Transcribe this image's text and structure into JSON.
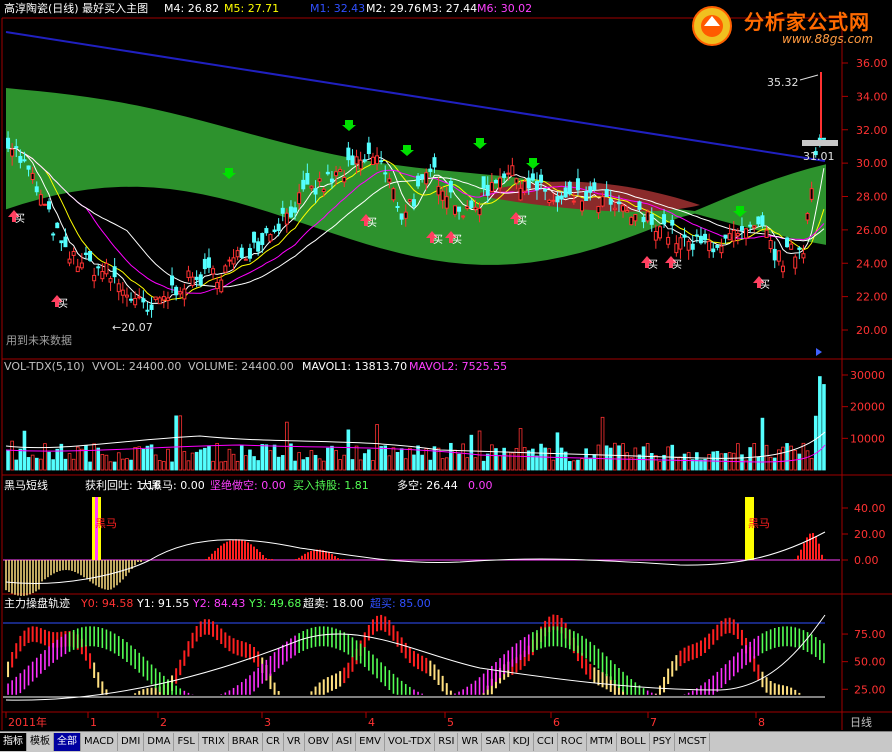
{
  "colors": {
    "up": "#ff3232",
    "down": "#54ffff",
    "ma_white": "#ffffff",
    "ma_yellow": "#ffff00",
    "ma_magenta": "#ff00ff",
    "ma_green": "#00ff00",
    "trend_blue": "#2020c0",
    "cloud_green": "#2f9a2f",
    "cloud_red": "#8a2a2a",
    "grid": "#b00000",
    "panel_border": "#a00000",
    "label_cyan": "#c0c0c0",
    "axis_text": "#ff3232"
  },
  "header": {
    "title": "高淳陶瓷(日线) 最好买入主图",
    "m4": "M4: 26.82",
    "m5": "M5: 27.71",
    "m1": "M1: 32.43",
    "m2": "M2: 29.76",
    "m3": "M3: 27.44",
    "m6": "M6: 30.02"
  },
  "watermark": {
    "brand": "分析家公式网",
    "url": "www.88gs.com"
  },
  "main_chart": {
    "price_axis": [
      "36.00",
      "34.00",
      "32.00",
      "30.00",
      "28.00",
      "26.00",
      "24.00",
      "22.00",
      "20.00"
    ],
    "high_label": "35.32",
    "low_label": "20.07",
    "last_label": "31.01",
    "future_note": "用到未来数据",
    "buy_marker_text": "买"
  },
  "volume_panel": {
    "title": "VOL-TDX(5,10)",
    "vvol": "VVOL: 24400.00",
    "volume": "VOLUME: 24400.00",
    "mavol1": "MAVOL1: 13813.70",
    "mavol2": "MAVOL2: 7525.55",
    "axis": [
      "30000",
      "20000",
      "10000"
    ]
  },
  "horse_panel": {
    "title": "黑马短线",
    "profit_back": "获利回吐: 1.16",
    "dark_horse": "大黑马: 0.00",
    "firm_empty": "坚绝做空: 0.00",
    "buy_hold": "买入持股: 1.81",
    "long_short": "多空: 26.44",
    "long_short_val2": "0.00",
    "marker": "黑马",
    "axis": [
      "40.00",
      "20.00",
      "0.00"
    ]
  },
  "track_panel": {
    "title": "主力操盘轨迹",
    "y0": "Y0: 94.58",
    "y1": "Y1: 91.55",
    "y2": "Y2: 84.43",
    "y3": "Y3: 49.68",
    "overbought": "超卖: 18.00",
    "oversold": "超买: 85.00",
    "axis": [
      "75.00",
      "50.00",
      "25.00"
    ]
  },
  "date_axis": {
    "labels": [
      "2011年",
      "1",
      "2",
      "3",
      "4",
      "5",
      "6",
      "7",
      "8"
    ],
    "period": "日线"
  },
  "tabs": [
    "指标",
    "模板",
    "全部",
    "MACD",
    "DMI",
    "DMA",
    "FSL",
    "TRIX",
    "BRAR",
    "CR",
    "VR",
    "OBV",
    "ASI",
    "EMV",
    "VOL-TDX",
    "RSI",
    "WR",
    "SAR",
    "KDJ",
    "CCI",
    "ROC",
    "MTM",
    "BOLL",
    "PSY",
    "MCST"
  ]
}
